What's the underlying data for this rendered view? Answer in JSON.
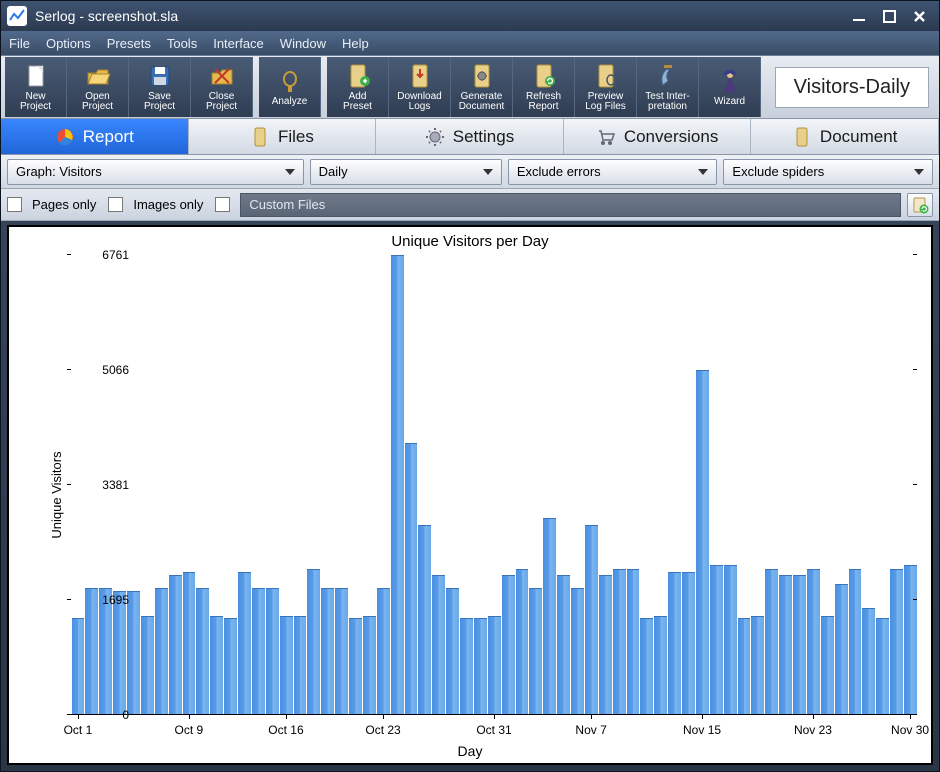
{
  "window": {
    "title": "Serlog - screenshot.sla"
  },
  "menu": {
    "items": [
      "File",
      "Options",
      "Presets",
      "Tools",
      "Interface",
      "Window",
      "Help"
    ]
  },
  "toolbar": {
    "buttons": [
      {
        "label": "New\nProject"
      },
      {
        "label": "Open\nProject"
      },
      {
        "label": "Save\nProject"
      },
      {
        "label": "Close\nProject"
      },
      {
        "label": "Analyze"
      },
      {
        "label": "Add\nPreset"
      },
      {
        "label": "Download\nLogs"
      },
      {
        "label": "Generate\nDocument"
      },
      {
        "label": "Refresh\nReport"
      },
      {
        "label": "Preview\nLog Files"
      },
      {
        "label": "Test Inter-\npretation"
      },
      {
        "label": "Wizard"
      }
    ],
    "info": "Visitors-Daily"
  },
  "tabs": {
    "items": [
      {
        "label": "Report",
        "active": true
      },
      {
        "label": "Files"
      },
      {
        "label": "Settings"
      },
      {
        "label": "Conversions"
      },
      {
        "label": "Document"
      }
    ]
  },
  "filters": {
    "graph": "Graph: Visitors",
    "period": "Daily",
    "errors": "Exclude errors",
    "spiders": "Exclude spiders"
  },
  "options": {
    "pages_only": "Pages only",
    "images_only": "Images only",
    "custom_files": "Custom Files"
  },
  "chart_data": {
    "type": "bar",
    "title": "Unique Visitors per Day",
    "xlabel": "Day",
    "ylabel": "Unique Visitors",
    "ylim": [
      0,
      6761
    ],
    "yticks": [
      0,
      1695,
      3381,
      5066,
      6761
    ],
    "xticks": [
      "Oct 1",
      "Oct 9",
      "Oct 16",
      "Oct 23",
      "Oct 31",
      "Nov 7",
      "Nov 15",
      "Nov 23",
      "Nov 30"
    ],
    "xtick_indices": [
      0,
      8,
      15,
      22,
      30,
      37,
      45,
      53,
      60
    ],
    "categories": [
      "Oct 1",
      "Oct 2",
      "Oct 3",
      "Oct 4",
      "Oct 5",
      "Oct 6",
      "Oct 7",
      "Oct 8",
      "Oct 9",
      "Oct 10",
      "Oct 11",
      "Oct 12",
      "Oct 13",
      "Oct 14",
      "Oct 15",
      "Oct 16",
      "Oct 17",
      "Oct 18",
      "Oct 19",
      "Oct 20",
      "Oct 21",
      "Oct 22",
      "Oct 23",
      "Oct 24",
      "Oct 25",
      "Oct 26",
      "Oct 27",
      "Oct 28",
      "Oct 29",
      "Oct 30",
      "Oct 31",
      "Nov 1",
      "Nov 2",
      "Nov 3",
      "Nov 4",
      "Nov 5",
      "Nov 6",
      "Nov 7",
      "Nov 8",
      "Nov 9",
      "Nov 10",
      "Nov 11",
      "Nov 12",
      "Nov 13",
      "Nov 14",
      "Nov 15",
      "Nov 16",
      "Nov 17",
      "Nov 18",
      "Nov 19",
      "Nov 20",
      "Nov 21",
      "Nov 22",
      "Nov 23",
      "Nov 24",
      "Nov 25",
      "Nov 26",
      "Nov 27",
      "Nov 28",
      "Nov 29",
      "Nov 30"
    ],
    "values": [
      1430,
      1870,
      1870,
      1830,
      1830,
      1450,
      1870,
      2060,
      2100,
      1870,
      1450,
      1430,
      2100,
      1870,
      1870,
      1450,
      1450,
      2150,
      1870,
      1870,
      1430,
      1450,
      1870,
      6761,
      4000,
      2800,
      2060,
      1870,
      1430,
      1430,
      1450,
      2060,
      2150,
      1870,
      2900,
      2060,
      1870,
      2800,
      2060,
      2150,
      2150,
      1430,
      1450,
      2100,
      2100,
      5066,
      2200,
      2200,
      1430,
      1450,
      2150,
      2060,
      2060,
      2150,
      1450,
      1930,
      2150,
      1580,
      1430,
      2150,
      2200
    ]
  }
}
